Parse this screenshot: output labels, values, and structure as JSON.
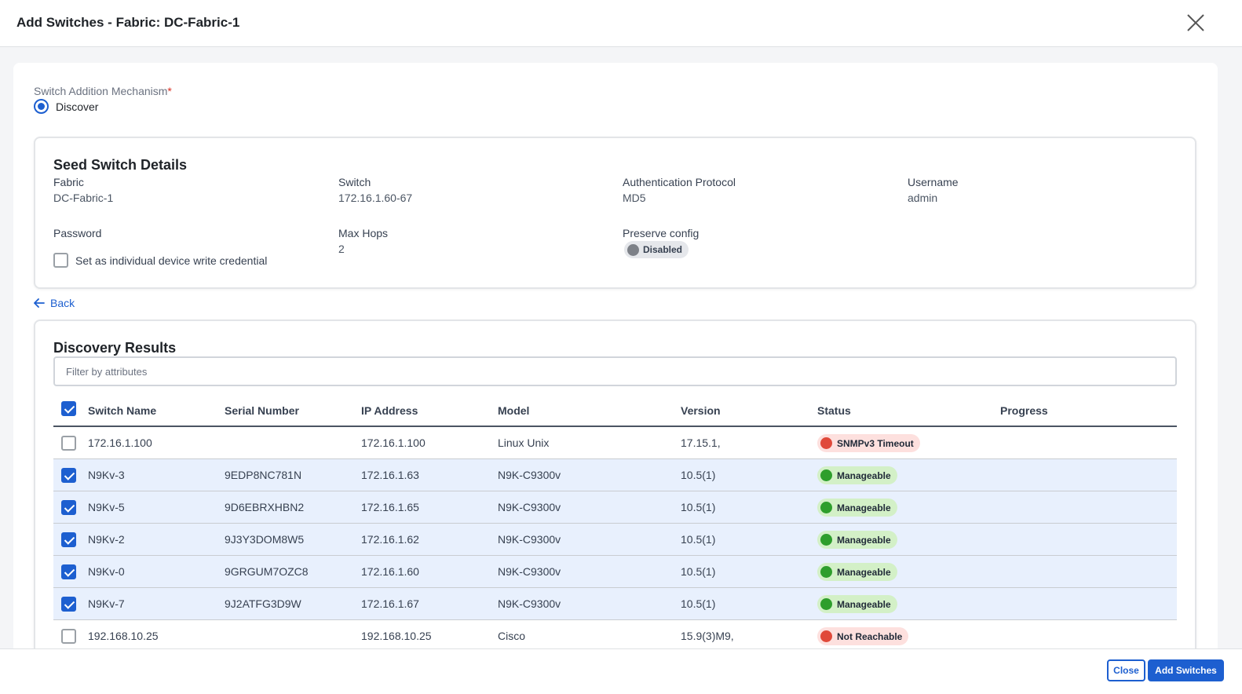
{
  "header": {
    "title": "Add Switches - Fabric: DC-Fabric-1"
  },
  "mechanism": {
    "label": "Switch Addition Mechanism",
    "required_mark": "*",
    "option": "Discover"
  },
  "seed": {
    "title": "Seed Switch Details",
    "fabric_label": "Fabric",
    "fabric_value": "DC-Fabric-1",
    "switch_label": "Switch",
    "switch_value": "172.16.1.60-67",
    "auth_label": "Authentication Protocol",
    "auth_value": "MD5",
    "username_label": "Username",
    "username_value": "admin",
    "password_label": "Password",
    "write_cred_label": "Set as individual device write credential",
    "maxhops_label": "Max Hops",
    "maxhops_value": "2",
    "preserve_label": "Preserve config",
    "preserve_value": "Disabled"
  },
  "back": {
    "label": "Back"
  },
  "discovery": {
    "title": "Discovery Results",
    "filter_placeholder": "Filter by attributes",
    "columns": [
      "Switch Name",
      "Serial Number",
      "IP Address",
      "Model",
      "Version",
      "Status",
      "Progress"
    ],
    "rows": [
      {
        "name": "172.16.1.100",
        "serial": "",
        "ip": "172.16.1.100",
        "model": "Linux Unix",
        "version": "17.15.1,",
        "status": "SNMPv3 Timeout",
        "status_kind": "bad",
        "selected": false
      },
      {
        "name": "N9Kv-3",
        "serial": "9EDP8NC781N",
        "ip": "172.16.1.63",
        "model": "N9K-C9300v",
        "version": "10.5(1)",
        "status": "Manageable",
        "status_kind": "ok",
        "selected": true
      },
      {
        "name": "N9Kv-5",
        "serial": "9D6EBRXHBN2",
        "ip": "172.16.1.65",
        "model": "N9K-C9300v",
        "version": "10.5(1)",
        "status": "Manageable",
        "status_kind": "ok",
        "selected": true
      },
      {
        "name": "N9Kv-2",
        "serial": "9J3Y3DOM8W5",
        "ip": "172.16.1.62",
        "model": "N9K-C9300v",
        "version": "10.5(1)",
        "status": "Manageable",
        "status_kind": "ok",
        "selected": true
      },
      {
        "name": "N9Kv-0",
        "serial": "9GRGUM7OZC8",
        "ip": "172.16.1.60",
        "model": "N9K-C9300v",
        "version": "10.5(1)",
        "status": "Manageable",
        "status_kind": "ok",
        "selected": true
      },
      {
        "name": "N9Kv-7",
        "serial": "9J2ATFG3D9W",
        "ip": "172.16.1.67",
        "model": "N9K-C9300v",
        "version": "10.5(1)",
        "status": "Manageable",
        "status_kind": "ok",
        "selected": true
      },
      {
        "name": "192.168.10.25",
        "serial": "",
        "ip": "192.168.10.25",
        "model": "Cisco",
        "version": "15.9(3)M9,",
        "status": "Not Reachable",
        "status_kind": "bad",
        "selected": false
      }
    ]
  },
  "footer": {
    "close_label": "Close",
    "add_label": "Add Switches"
  },
  "colors": {
    "accent": "#1d5fd0",
    "ok": "#2e9e2c",
    "error": "#e0493a",
    "selected_row": "#e8f0fd"
  }
}
